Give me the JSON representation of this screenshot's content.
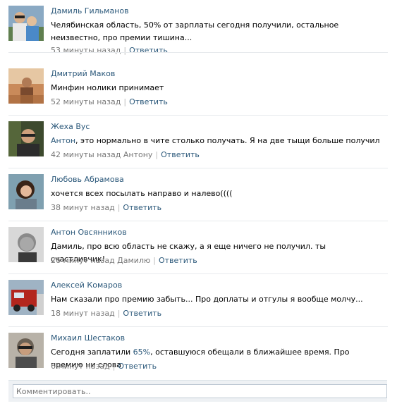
{
  "comments": [
    {
      "author": "Дамиль Гильманов",
      "text": "Челябинская область, 50% от зарплаты сегодня получили, остальное неизвестно, про премии тишина...",
      "time": "53 минуты назад",
      "reply": "Ответить",
      "avatar_icon": "user-photo"
    },
    {
      "author": "Дмитрий Маков",
      "text": "Минфин нолики принимает",
      "time": "52 минуты назад",
      "reply": "Ответить",
      "avatar_icon": "user-photo"
    },
    {
      "author": "Жеха Вус",
      "mention": "Антон",
      "text": ", это нормально в чите столько получать. Я на две тыщи больше получил",
      "time": "42 минуты назад Антону",
      "reply": "Ответить",
      "avatar_icon": "user-photo"
    },
    {
      "author": "Любовь Абрамова",
      "text": "хочется всех посылать направо и налево((((",
      "time": "38 минут назад",
      "reply": "Ответить",
      "avatar_icon": "user-photo"
    },
    {
      "author": "Антон Овсянников",
      "text": "Дамиль, про всю область не скажу, а я еще ничего не получил. ты счастливчик!",
      "time": "26 минут назад Дамилю",
      "reply": "Ответить",
      "avatar_icon": "user-photo"
    },
    {
      "author": "Алексей Комаров",
      "text": "Нам сказали про премию забыть... Про доплаты и отгулы я вообще молчу...",
      "time": "18 минут назад",
      "reply": "Ответить",
      "avatar_icon": "user-photo"
    },
    {
      "author": "Михаил Шестаков",
      "text_before": "Сегодня заплатили ",
      "text_highlight": "65%",
      "text_after": ", оставшуюся обещали в ближайшее время. Про премию ни слова",
      "time": "6 минут назад",
      "reply": "Ответить",
      "avatar_icon": "user-photo"
    }
  ],
  "comment_box": {
    "placeholder": "Комментировать.."
  },
  "colors": {
    "link": "#2b587a",
    "meta": "#777777",
    "divider": "#e7eaed",
    "input_border": "#c0cad5",
    "box_background": "#eef1f4"
  }
}
